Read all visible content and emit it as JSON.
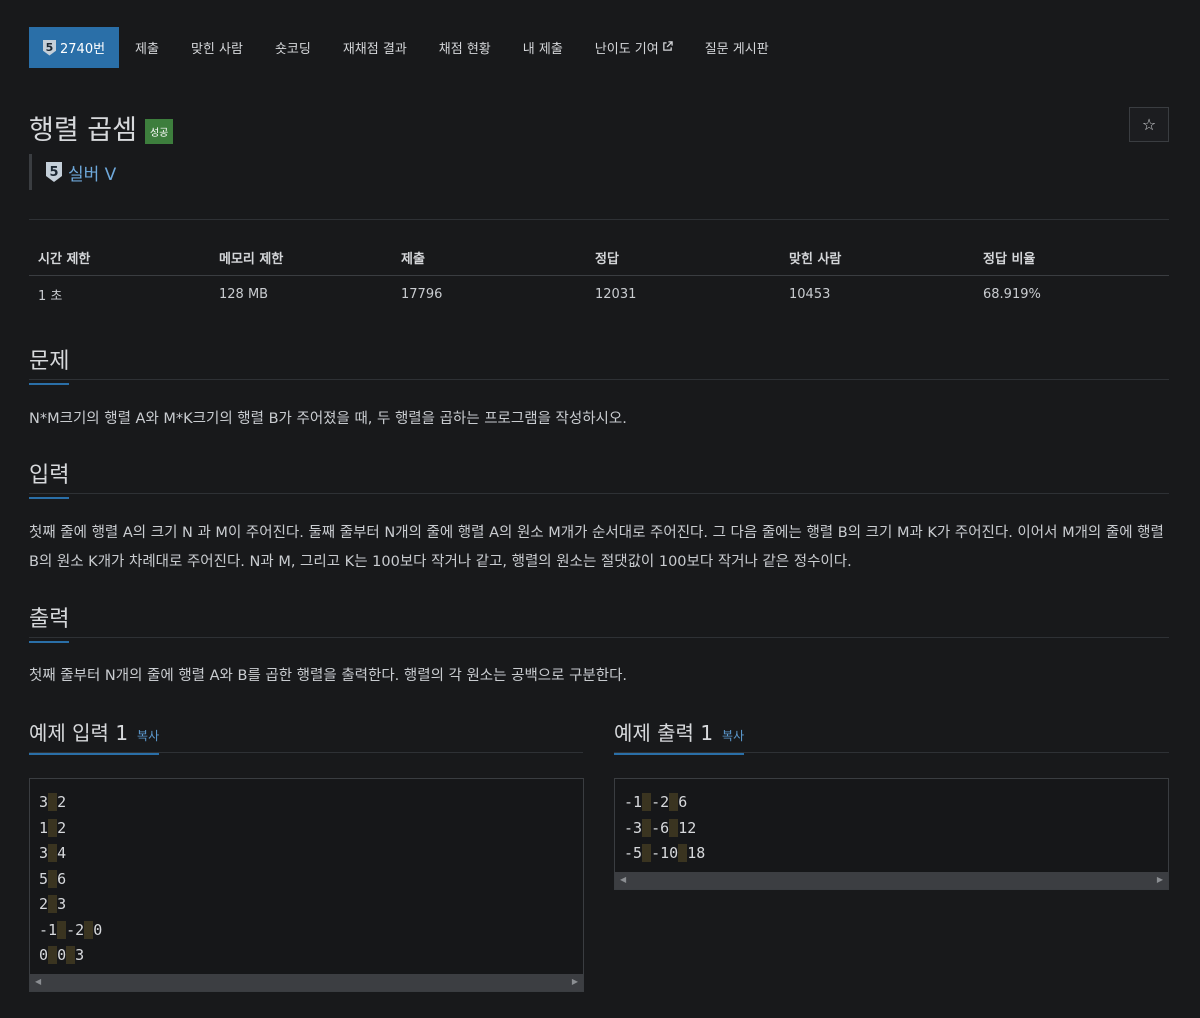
{
  "tabs": [
    {
      "label": "2740번",
      "tier": "5",
      "active": true
    },
    {
      "label": "제출"
    },
    {
      "label": "맞힌 사람"
    },
    {
      "label": "숏코딩"
    },
    {
      "label": "재채점 결과"
    },
    {
      "label": "채점 현황"
    },
    {
      "label": "내 제출"
    },
    {
      "label": "난이도 기여"
    },
    {
      "label": "질문 게시판"
    }
  ],
  "problem": {
    "title": "행렬 곱셈",
    "status_badge": "성공",
    "tier_number": "5",
    "tier_name": "실버 V",
    "star": "☆"
  },
  "info": {
    "headers": [
      "시간 제한",
      "메모리 제한",
      "제출",
      "정답",
      "맞힌 사람",
      "정답 비율"
    ],
    "values": [
      "1 초",
      "128 MB",
      "17796",
      "12031",
      "10453",
      "68.919%"
    ]
  },
  "sections": {
    "problem_heading": "문제",
    "problem_text": "N*M크기의 행렬 A와 M*K크기의 행렬 B가 주어졌을 때, 두 행렬을 곱하는 프로그램을 작성하시오.",
    "input_heading": "입력",
    "input_text": "첫째 줄에 행렬 A의 크기 N 과 M이 주어진다. 둘째 줄부터 N개의 줄에 행렬 A의 원소 M개가 순서대로 주어진다. 그 다음 줄에는 행렬 B의 크기 M과 K가 주어진다. 이어서 M개의 줄에 행렬 B의 원소 K개가 차례대로 주어진다. N과 M, 그리고 K는 100보다 작거나 같고, 행렬의 원소는 절댓값이 100보다 작거나 같은 정수이다.",
    "output_heading": "출력",
    "output_text": "첫째 줄부터 N개의 줄에 행렬 A와 B를 곱한 행렬을 출력한다. 행렬의 각 원소는 공백으로 구분한다."
  },
  "examples": {
    "input_title": "예제 입력 1",
    "output_title": "예제 출력 1",
    "copy_label": "복사",
    "input_lines": [
      [
        "3",
        "2"
      ],
      [
        "1",
        "2"
      ],
      [
        "3",
        "4"
      ],
      [
        "5",
        "6"
      ],
      [
        "2",
        "3"
      ],
      [
        "-1",
        "-2",
        "0"
      ],
      [
        "0",
        "0",
        "3"
      ]
    ],
    "output_lines": [
      [
        "-1",
        "-2",
        "6"
      ],
      [
        "-3",
        "-6",
        "12"
      ],
      [
        "-5",
        "-10",
        "18"
      ]
    ]
  },
  "colors": {
    "background": "#18191b",
    "accent": "#2a6fa8",
    "success": "#3d7e3d",
    "tier_link": "#6ea8da"
  }
}
